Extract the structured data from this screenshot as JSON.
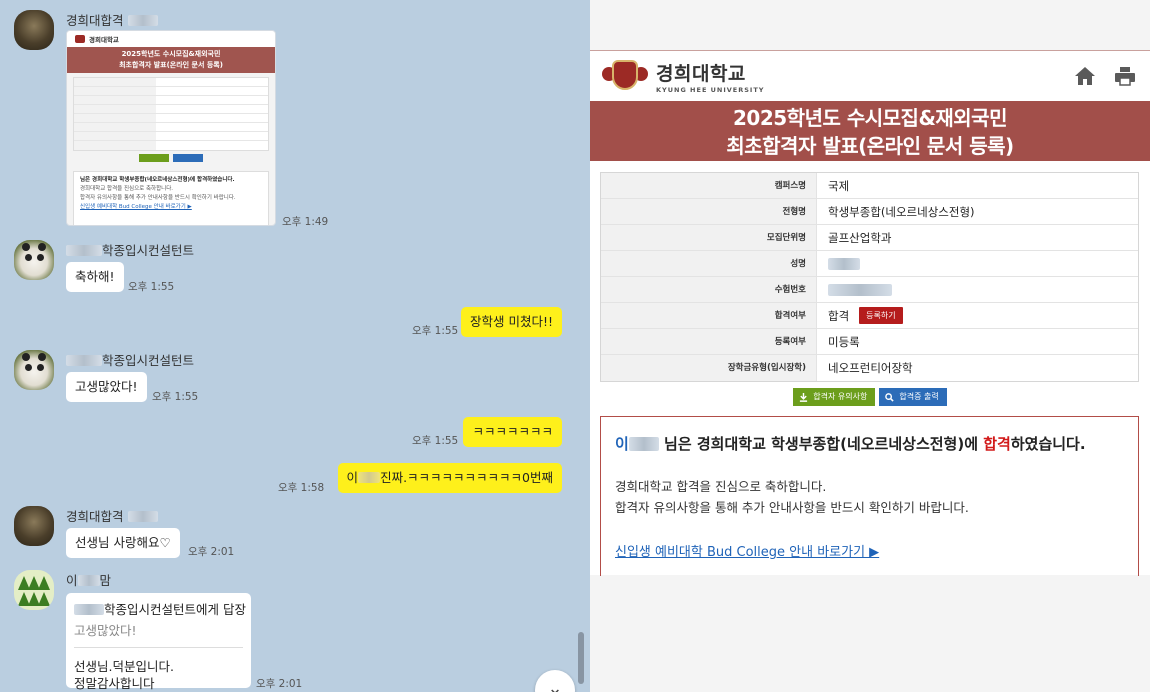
{
  "chat": {
    "messages": [
      {
        "sender": "경희대합격",
        "type": "image",
        "time": "오후 1:49"
      },
      {
        "sender": "학종입시컨설턴트",
        "text": "축하해!",
        "time": "오후 1:55"
      },
      {
        "mine": true,
        "text": "장학생 미쳤다!!",
        "time": "오후 1:55"
      },
      {
        "sender": "학종입시컨설턴트",
        "text": "고생많았다!",
        "time": "오후 1:55"
      },
      {
        "mine": true,
        "text": "ㅋㅋㅋㅋㅋㅋㅋ",
        "time": "오후 1:55"
      },
      {
        "mine": true,
        "text_prefix": "이",
        "text": "진짜.ㅋㅋㅋㅋㅋㅋㅋㅋㅋㅋ0번째",
        "time": "오후 1:58"
      },
      {
        "sender": "경희대합격",
        "text": "선생님 사랑해요♡",
        "time": "오후 2:01"
      },
      {
        "sender_prefix": "이",
        "sender": "맘",
        "time": "오후 2:01",
        "reply": {
          "to": "학종입시컨설턴트에게 답장",
          "quote": "고생많았다!",
          "lines": [
            "선생님.덕분입니다.",
            "정말감사합니다"
          ]
        }
      }
    ],
    "scroll_down_glyph": "⌄"
  },
  "screenshot_thumb": {
    "logo_text": "경희대학교",
    "banner": [
      "2025학년도 수시모집&재외국민",
      "최초합격자 발표(온라인 문서 등록)"
    ],
    "notice_title": "님은 경희대학교 학생부종합(네오르네상스전형)에 합격하였습니다.",
    "body": [
      "경희대학교 합격을 진심으로 축하합니다.",
      "합격자 유의사항을 통해 추가 안내사항을 반드시 확인하기 바랍니다."
    ],
    "link": "신입생 예비대학 Bud College 안내 바로가기 ▶"
  },
  "page": {
    "univ_ko": "경희대학교",
    "univ_en": "KYUNG HEE UNIVERSITY",
    "banner_line1": "2025학년도 수시모집&재외국민",
    "banner_line2": "최초합격자 발표(온라인 문서 등록)",
    "rows": [
      {
        "label": "캠퍼스명",
        "value": "국제"
      },
      {
        "label": "전형명",
        "value": "학생부종합(네오르네상스전형)"
      },
      {
        "label": "모집단위명",
        "value": "골프산업학과"
      },
      {
        "label": "성명",
        "value": ""
      },
      {
        "label": "수험번호",
        "value": ""
      },
      {
        "label": "합격여부",
        "value": "합격",
        "button": "등록하기"
      },
      {
        "label": "등록여부",
        "value": "미등록"
      },
      {
        "label": "장학금유형(입시장학)",
        "value": "네오프런티어장학"
      }
    ],
    "btn_notice": "합격자 유의사항",
    "btn_print": "합격증 출력",
    "notice_prefix": "이",
    "notice_title_a": "님은 경희대학교 학생부종합(네오르네상스전형)에 ",
    "notice_title_red": "합격",
    "notice_title_b": "하였습니다.",
    "notice_body_1": "경희대학교 합격을 진심으로 축하합니다.",
    "notice_body_2": "합격자 유의사항을 통해 추가 안내사항을 반드시 확인하기 바랍니다.",
    "notice_link": "신입생 예비대학 Bud College 안내 바로가기 ▶"
  },
  "colors": {
    "chat_bg": "#bacee0",
    "my_bubble": "#fef01b",
    "banner": "#a24f4a",
    "accent_red": "#b51c1c",
    "link_blue": "#1f63b8"
  }
}
